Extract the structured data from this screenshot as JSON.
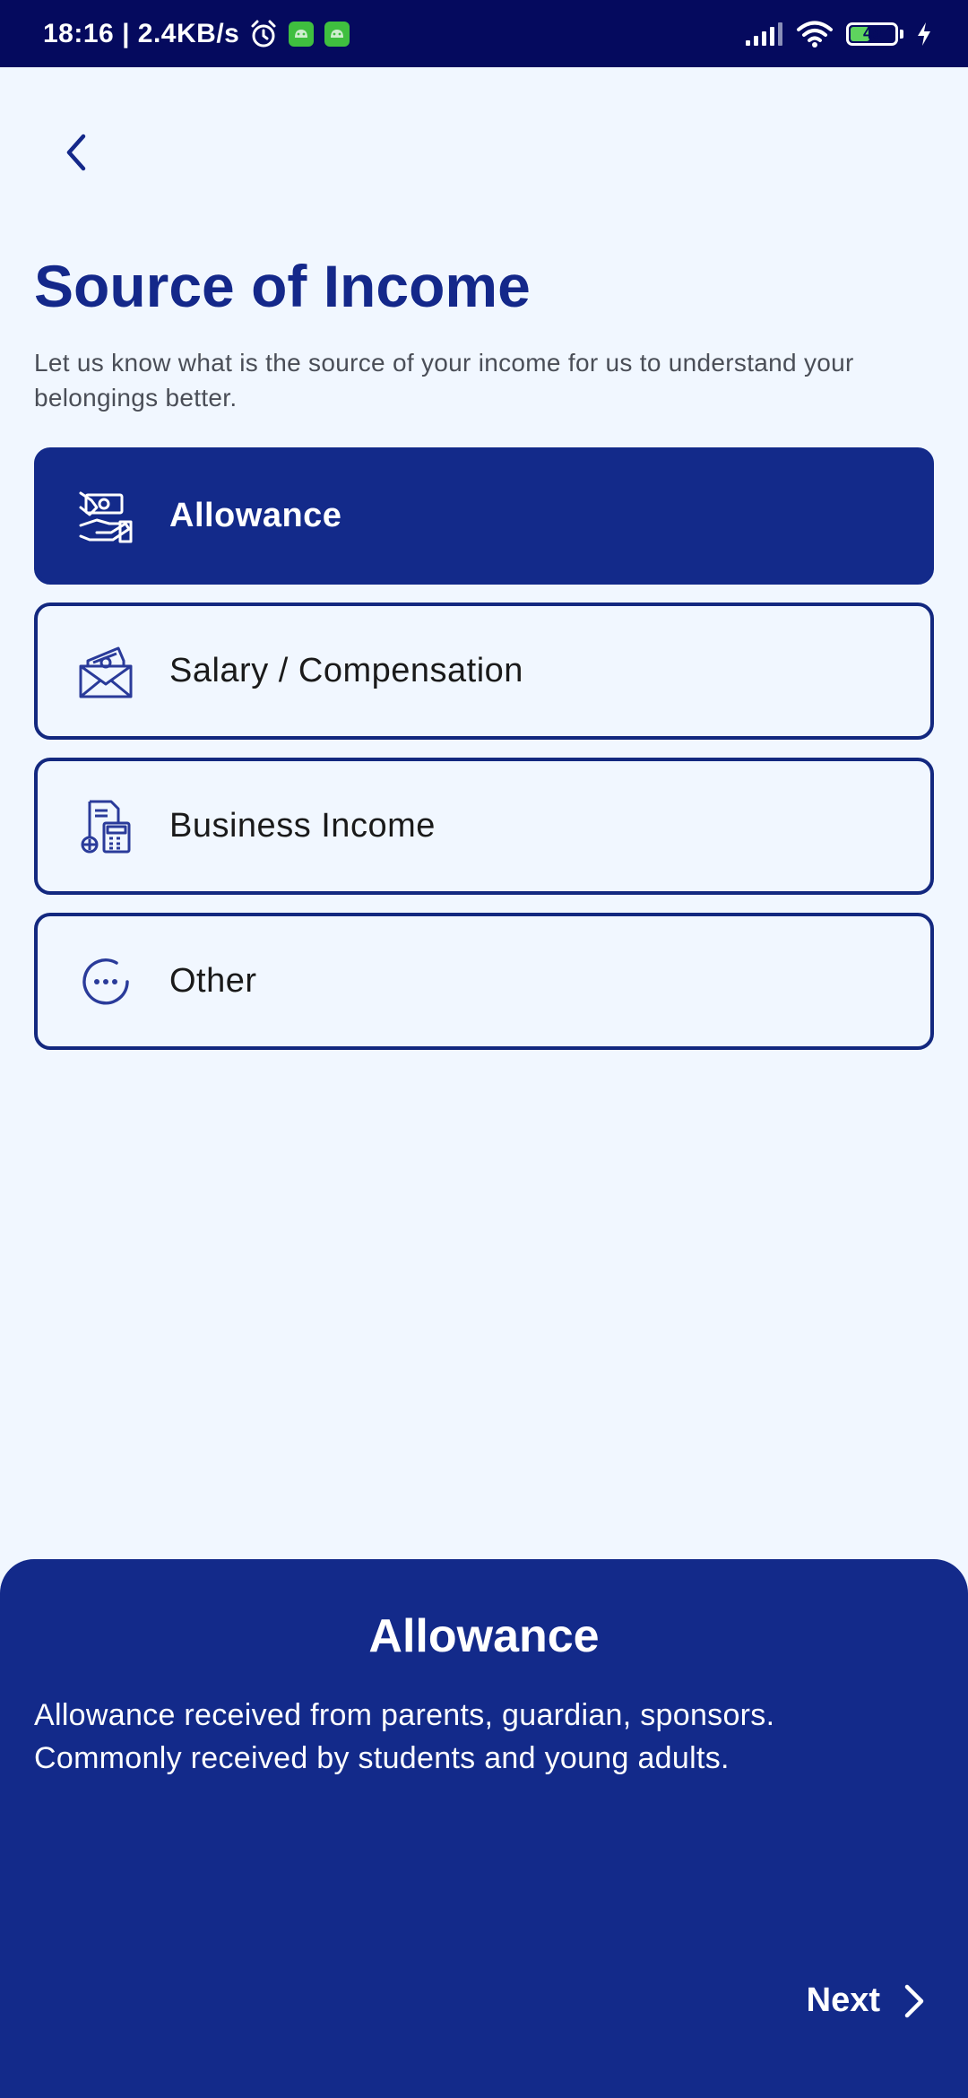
{
  "status_bar": {
    "time_speed": "18:16 | 2.4KB/s",
    "battery_level": "49"
  },
  "header": {
    "title": "Source of Income",
    "subtitle": "Let us know what is the source of your income for us to understand your belongings better."
  },
  "options": [
    {
      "label": "Allowance",
      "icon": "hand-money-icon",
      "selected": true
    },
    {
      "label": "Salary / Compensation",
      "icon": "envelope-money-icon",
      "selected": false
    },
    {
      "label": "Business Income",
      "icon": "business-calculator-icon",
      "selected": false
    },
    {
      "label": "Other",
      "icon": "more-options-icon",
      "selected": false
    }
  ],
  "detail": {
    "title": "Allowance",
    "description": "Allowance received from parents, guardian, sponsors. Commonly received by students and young adults."
  },
  "footer": {
    "next_label": "Next"
  },
  "colors": {
    "primary": "#132a8a",
    "status_bar": "#050a5e",
    "background": "#f1f7ff",
    "battery": "#5ed45e"
  }
}
